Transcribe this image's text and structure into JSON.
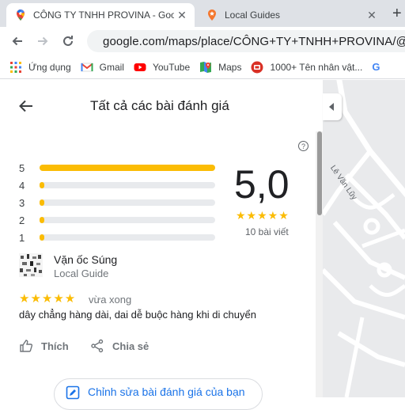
{
  "browser": {
    "tabs": [
      {
        "title": "CÔNG TY TNHH PROVINA - Goo",
        "favicon": "google-maps-icon"
      },
      {
        "title": "Local Guides",
        "favicon": "local-guides-icon"
      }
    ],
    "url": "google.com/maps/place/CÔNG+TY+TNHH+PROVINA/@10.",
    "bookmarks": [
      {
        "label": "Ứng dụng",
        "icon": "apps-grid-icon"
      },
      {
        "label": "Gmail",
        "icon": "gmail-icon"
      },
      {
        "label": "YouTube",
        "icon": "youtube-icon"
      },
      {
        "label": "Maps",
        "icon": "maps-icon"
      },
      {
        "label": "1000+ Tên nhân vật...",
        "icon": "bookmark-site-icon"
      }
    ]
  },
  "panel": {
    "title": "Tất cả các bài đánh giá",
    "rating_bars": [
      {
        "label": "5",
        "fraction": 1.0
      },
      {
        "label": "4",
        "fraction": 0.0
      },
      {
        "label": "3",
        "fraction": 0.0
      },
      {
        "label": "2",
        "fraction": 0.0
      },
      {
        "label": "1",
        "fraction": 0.0
      }
    ],
    "score": "5,0",
    "stars": "★★★★★",
    "review_count": "10 bài viết",
    "review": {
      "author": "Vặn ốc Súng",
      "author_sub": "Local Guide",
      "stars": "★★★★★",
      "time": "vừa xong",
      "text": "dây chẳng hàng dài, dai dễ buộc hàng khi di chuyển"
    },
    "actions": {
      "like": "Thích",
      "share": "Chia sẻ"
    },
    "edit_button": "Chỉnh sửa bài đánh giá của bạn"
  },
  "map": {
    "street_label": "Lê Văn Lũy"
  },
  "colors": {
    "star": "#fbbc04",
    "accent": "#1a73e8"
  }
}
